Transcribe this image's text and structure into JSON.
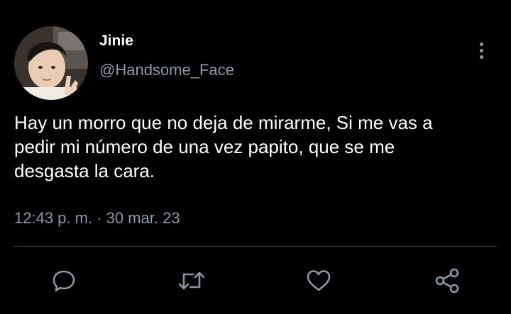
{
  "author": {
    "display_name": "Jinie",
    "handle": "@Handsome_Face"
  },
  "tweet": {
    "text_lines": [
      "Hay un morro que no deja de mirarme, Si me vas a",
      "pedir mi número de una vez papito, que se me",
      "desgasta la cara."
    ],
    "time": "12:43 p. m.",
    "separator": " · ",
    "date": "30 mar. 23"
  },
  "icons": {
    "more": "more-vertical-icon",
    "reply": "reply-icon",
    "retweet": "retweet-icon",
    "like": "heart-icon",
    "share": "share-icon"
  },
  "colors": {
    "background": "#000000",
    "primary_text": "#ffffff",
    "secondary_text": "#8b98a5",
    "divider": "#38444d",
    "icon": "#8b98a5"
  }
}
